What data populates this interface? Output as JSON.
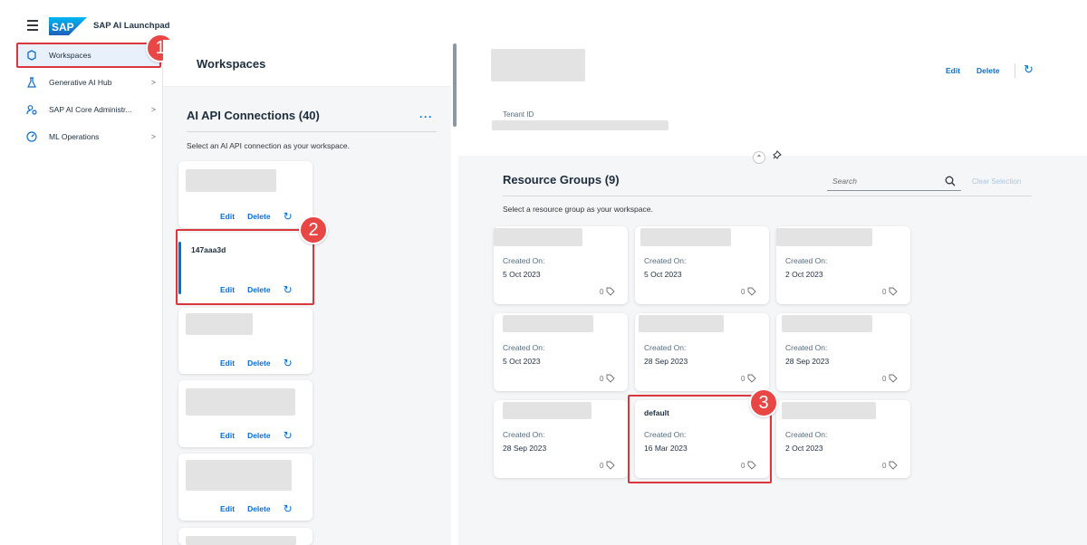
{
  "shell": {
    "app_title": "SAP AI Launchpad",
    "logo_text": "SAP"
  },
  "sidenav": {
    "items": [
      {
        "label": "Workspaces",
        "icon": "workspace-icon",
        "chevron": ""
      },
      {
        "label": "Generative AI Hub",
        "icon": "flask-icon",
        "chevron": ">"
      },
      {
        "label": "SAP AI Core Administr...",
        "icon": "admin-icon",
        "chevron": ">"
      },
      {
        "label": "ML Operations",
        "icon": "gauge-icon",
        "chevron": ">"
      }
    ]
  },
  "workspaces": {
    "title": "Workspaces",
    "connections_title": "AI API Connections (40)",
    "more": "···",
    "subtitle": "Select an AI API connection as your workspace.",
    "edit_label": "Edit",
    "delete_label": "Delete",
    "selected_connection": "147aaa3d"
  },
  "details": {
    "edit_label": "Edit",
    "delete_label": "Delete",
    "tenant_label": "Tenant ID"
  },
  "resource_groups": {
    "title": "Resource Groups (9)",
    "search_placeholder": "Search",
    "clear_selection": "Clear Selection",
    "subtitle": "Select a resource group as your workspace.",
    "created_label": "Created On:",
    "cards": [
      {
        "name": "",
        "date": "5 Oct 2023",
        "count": "0"
      },
      {
        "name": "",
        "date": "5 Oct 2023",
        "count": "0"
      },
      {
        "name": "",
        "date": "2 Oct 2023",
        "count": "0"
      },
      {
        "name": "",
        "date": "5 Oct 2023",
        "count": "0"
      },
      {
        "name": "",
        "date": "28 Sep 2023",
        "count": "0"
      },
      {
        "name": "",
        "date": "28 Sep 2023",
        "count": "0"
      },
      {
        "name": "",
        "date": "28 Sep 2023",
        "count": "0"
      },
      {
        "name": "default",
        "date": "16 Mar 2023",
        "count": "0"
      },
      {
        "name": "",
        "date": "2 Oct 2023",
        "count": "0"
      }
    ]
  },
  "callouts": [
    "1",
    "2",
    "3"
  ],
  "colors": {
    "accent": "#0a6ed1",
    "callout": "#e84745",
    "background": "#f5f6f7"
  }
}
